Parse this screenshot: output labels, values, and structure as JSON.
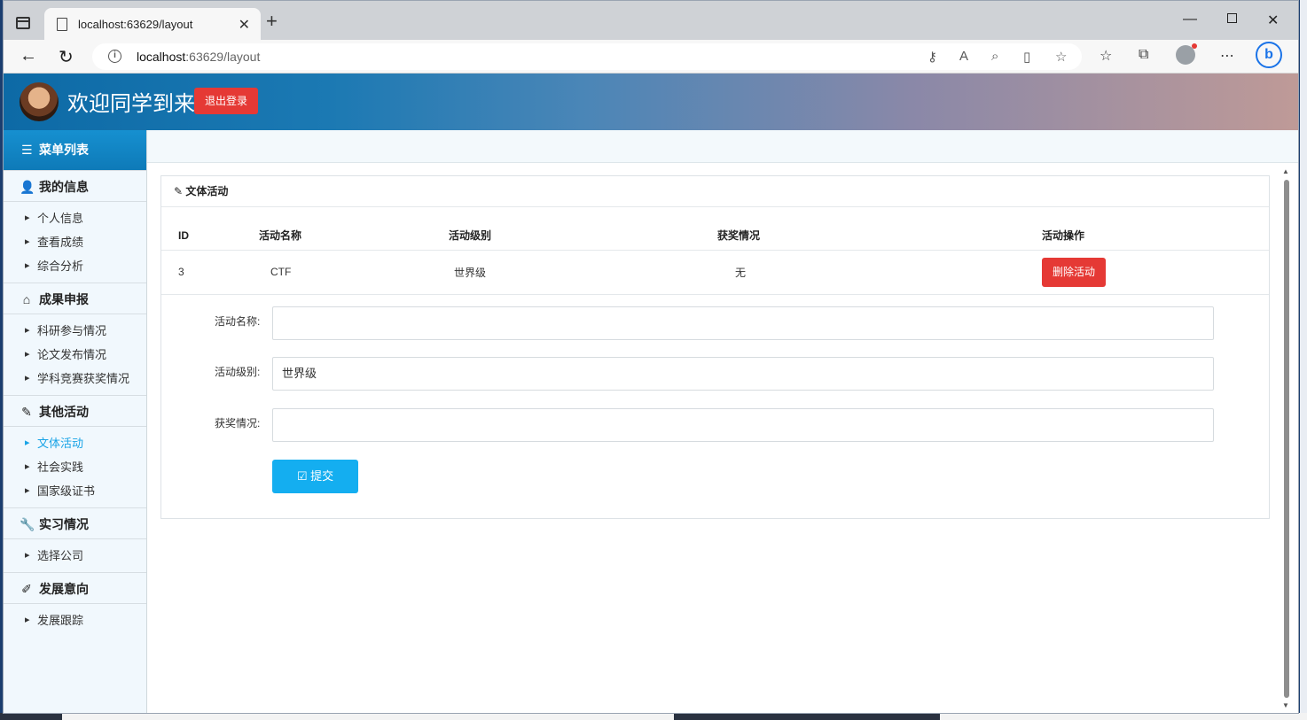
{
  "browser": {
    "tab_title": "localhost:63629/layout",
    "url_host": "localhost",
    "url_rest": ":63629/layout"
  },
  "header": {
    "welcome": "欢迎同学到来",
    "logout_label": "退出登录"
  },
  "sidebar": {
    "title": "菜单列表",
    "groups": [
      {
        "label": "我的信息",
        "items": [
          "个人信息",
          "查看成绩",
          "综合分析"
        ]
      },
      {
        "label": "成果申报",
        "items": [
          "科研参与情况",
          "论文发布情况",
          "学科竞赛获奖情况"
        ]
      },
      {
        "label": "其他活动",
        "items": [
          "文体活动",
          "社会实践",
          "国家级证书"
        ]
      },
      {
        "label": "实习情况",
        "items": [
          "选择公司"
        ]
      },
      {
        "label": "发展意向",
        "items": [
          "发展跟踪"
        ]
      }
    ],
    "active_item": "文体活动"
  },
  "panel": {
    "title": "文体活动",
    "columns": [
      "ID",
      "活动名称",
      "活动级别",
      "获奖情况",
      "活动操作"
    ],
    "rows": [
      {
        "id": "3",
        "name": "CTF",
        "level": "世界级",
        "award": "无",
        "action": "删除活动"
      }
    ],
    "form": {
      "name_label": "活动名称:",
      "name_value": "",
      "level_label": "活动级别:",
      "level_value": "世界级",
      "award_label": "获奖情况:",
      "award_value": "",
      "submit_label": "提交"
    }
  },
  "colors": {
    "primary": "#14aef0",
    "danger": "#e53935",
    "sidebar_title": "#1690d0"
  }
}
